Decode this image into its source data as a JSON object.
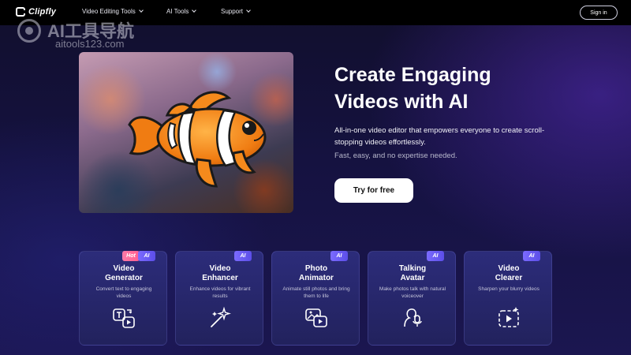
{
  "nav": {
    "brand": "Clipfly",
    "items": [
      {
        "label": "Video Editing Tools"
      },
      {
        "label": "AI Tools"
      },
      {
        "label": "Support"
      }
    ],
    "signin": "Sign in"
  },
  "watermark": {
    "title": "AI工具导航",
    "url": "aitools123.com"
  },
  "hero": {
    "title_line1": "Create Engaging",
    "title_line2": "Videos with AI",
    "description": "All-in-one video editor that empowers everyone to create scroll-stopping videos effortlessly.",
    "subtext": "Fast, easy, and no expertise needed.",
    "cta": "Try for free",
    "image_icon": "clownfish-image"
  },
  "cards": [
    {
      "title": "Video Generator",
      "description": "Convert text to engaging videos",
      "badges": [
        "Hot",
        "AI"
      ],
      "icon": "text-to-video-icon"
    },
    {
      "title": "Video Enhancer",
      "description": "Enhance videos for vibrant results",
      "badges": [
        "AI"
      ],
      "icon": "magic-wand-icon"
    },
    {
      "title": "Photo Animator",
      "description": "Animate still photos and bring them to life",
      "badges": [
        "AI"
      ],
      "icon": "photo-animate-icon"
    },
    {
      "title": "Talking Avatar",
      "description": "Make photos talk with natural voiceover",
      "badges": [
        "AI"
      ],
      "icon": "avatar-mic-icon"
    },
    {
      "title": "Video Clearer",
      "description": "Sharpen your blurry videos",
      "badges": [
        "AI"
      ],
      "icon": "video-sparkle-icon"
    }
  ],
  "colors": {
    "background": "#151240",
    "card": "#2c2c7a",
    "badge_ai": "#6a5cf5",
    "badge_hot": "#ff6b9a",
    "cta_bg": "#ffffff"
  }
}
